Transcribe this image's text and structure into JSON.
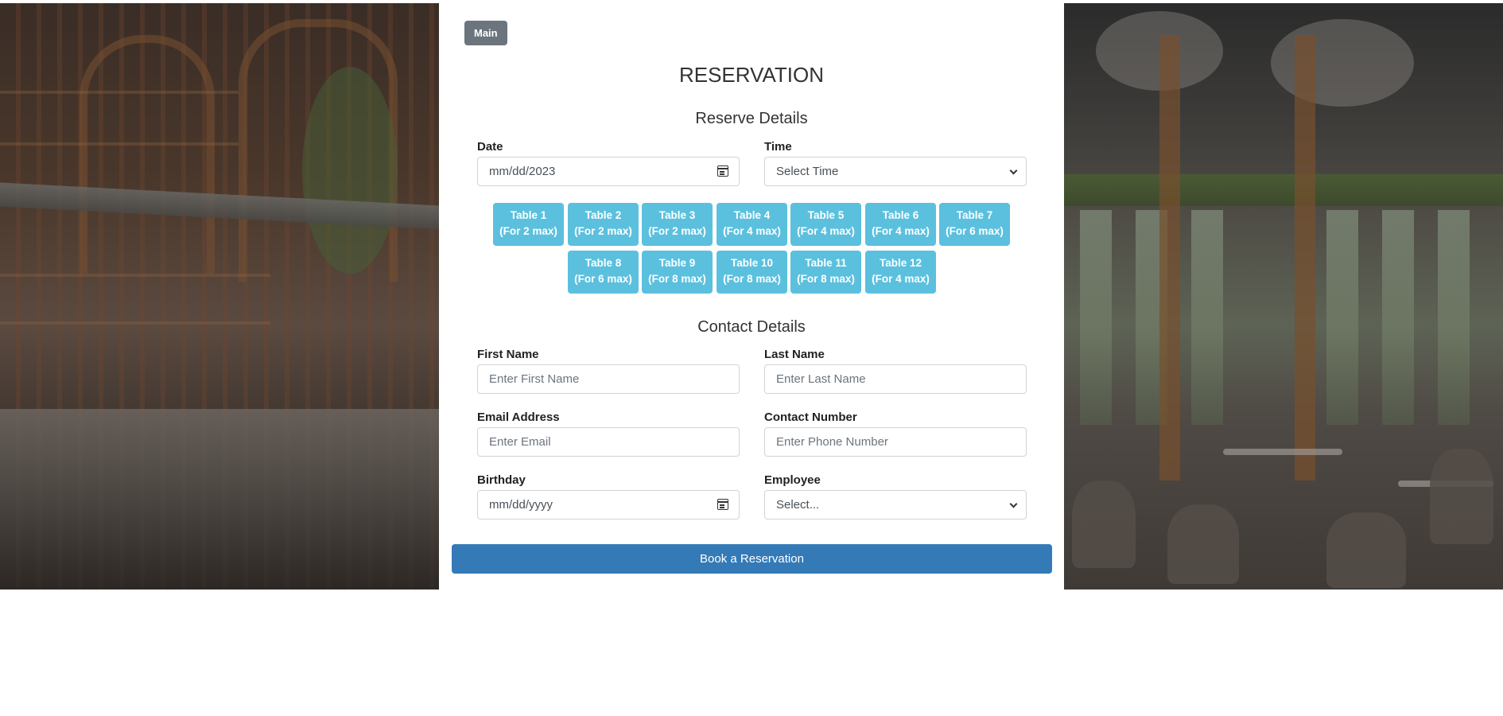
{
  "main_button": "Main",
  "title": "RESERVATION",
  "reserve_section": {
    "title": "Reserve Details",
    "date": {
      "label": "Date",
      "value": "mm/dd/2023"
    },
    "time": {
      "label": "Time",
      "value": "Select Time"
    }
  },
  "tables": [
    {
      "name": "Table 1",
      "cap": "(For 2 max)"
    },
    {
      "name": "Table 2",
      "cap": "(For 2 max)"
    },
    {
      "name": "Table 3",
      "cap": "(For 2 max)"
    },
    {
      "name": "Table 4",
      "cap": "(For 4 max)"
    },
    {
      "name": "Table 5",
      "cap": "(For 4 max)"
    },
    {
      "name": "Table 6",
      "cap": "(For 4 max)"
    },
    {
      "name": "Table 7",
      "cap": "(For 6 max)"
    },
    {
      "name": "Table 8",
      "cap": "(For 6 max)"
    },
    {
      "name": "Table 9",
      "cap": "(For 8 max)"
    },
    {
      "name": "Table 10",
      "cap": "(For 8 max)"
    },
    {
      "name": "Table 11",
      "cap": "(For 8 max)"
    },
    {
      "name": "Table 12",
      "cap": "(For 4 max)"
    }
  ],
  "contact_section": {
    "title": "Contact Details",
    "first_name": {
      "label": "First Name",
      "placeholder": "Enter First Name"
    },
    "last_name": {
      "label": "Last Name",
      "placeholder": "Enter Last Name"
    },
    "email": {
      "label": "Email Address",
      "placeholder": "Enter Email"
    },
    "phone": {
      "label": "Contact Number",
      "placeholder": "Enter Phone Number"
    },
    "birthday": {
      "label": "Birthday",
      "value": "mm/dd/yyyy"
    },
    "employee": {
      "label": "Employee",
      "value": "Select..."
    }
  },
  "book_button": "Book a Reservation",
  "colors": {
    "table_button": "#5bc0de",
    "primary": "#337ab7",
    "secondary": "#6c757d"
  }
}
